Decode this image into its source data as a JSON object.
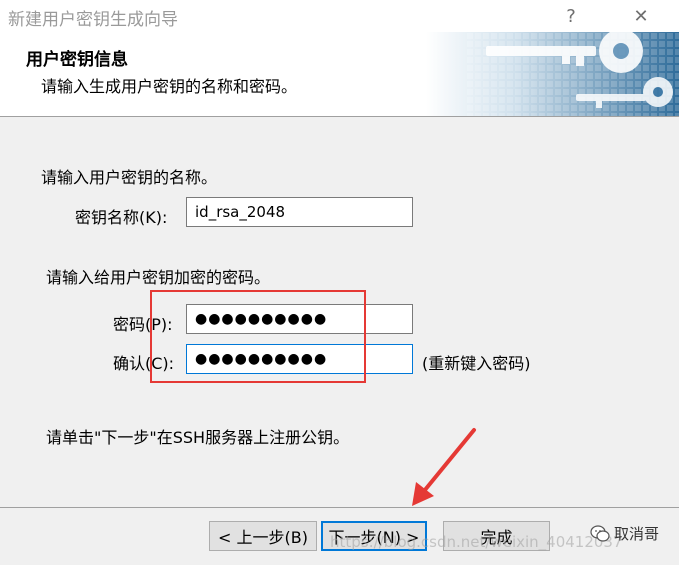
{
  "window": {
    "title": "新建用户密钥生成向导",
    "help_glyph": "?",
    "close_glyph": "✕"
  },
  "header": {
    "title": "用户密钥信息",
    "subtitle": "请输入生成用户密钥的名称和密码。"
  },
  "form": {
    "name_prompt": "请输入用户密钥的名称。",
    "name_label": "密钥名称(K):",
    "name_value": "id_rsa_2048",
    "password_prompt": "请输入给用户密钥加密的密码。",
    "password_label": "密码(P):",
    "password_value": "●●●●●●●●●●",
    "confirm_label": "确认(C):",
    "confirm_value": "●●●●●●●●●●",
    "confirm_hint": "(重新键入密码)",
    "instruction": "请单击\"下一步\"在SSH服务器上注册公钥。"
  },
  "buttons": {
    "back": "< 上一步(B)",
    "next": "下一步(N) >",
    "finish": "完成",
    "cancel": "取消"
  },
  "overlay": {
    "watermark": "https://blog.csdn.net/weixin_40412037",
    "wechat_name": "取消哥"
  },
  "colors": {
    "annotation": "#e53935",
    "focus": "#0078d7"
  }
}
